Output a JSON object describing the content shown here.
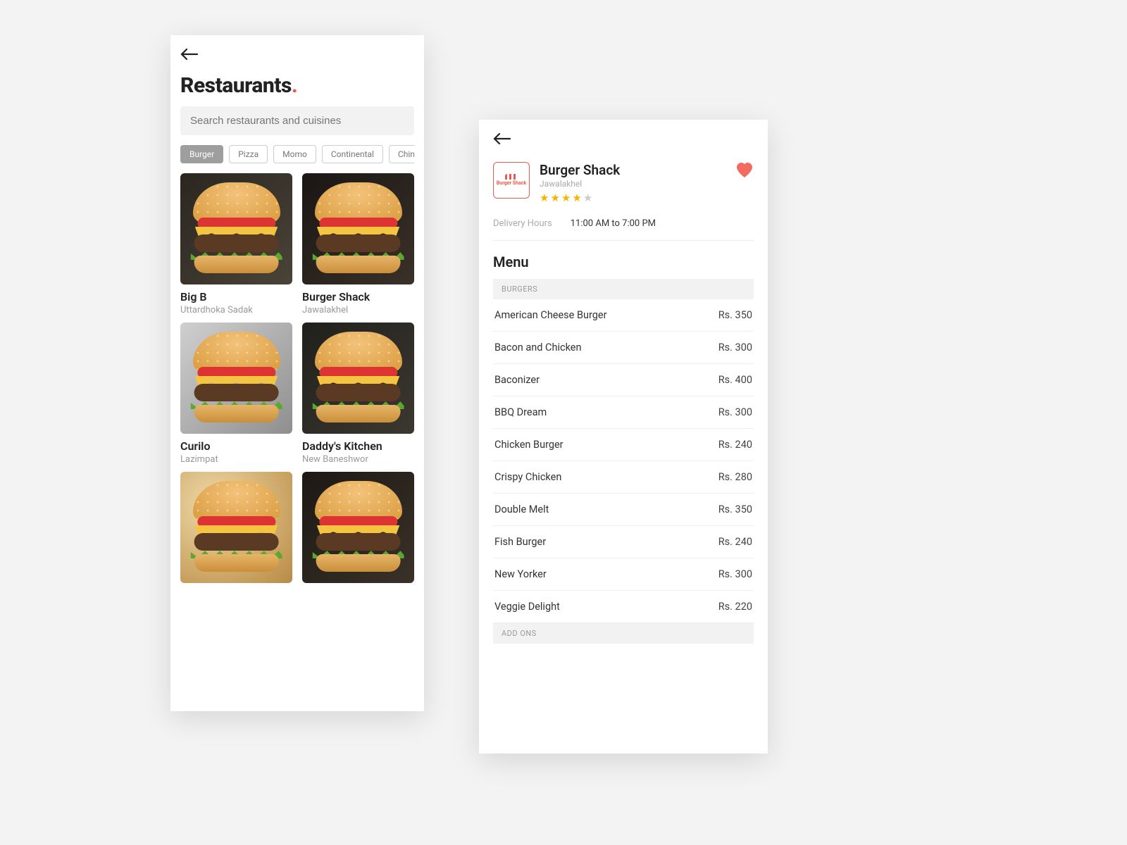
{
  "left": {
    "title": "Restaurants",
    "search_placeholder": "Search restaurants and cuisines",
    "chips": [
      "Burger",
      "Pizza",
      "Momo",
      "Continental",
      "Chinese"
    ],
    "active_chip_index": 0,
    "cards": [
      {
        "name": "Big B",
        "sub": "Uttardhoka Sadak"
      },
      {
        "name": "Burger Shack",
        "sub": "Jawalakhel"
      },
      {
        "name": "Curilo",
        "sub": "Lazimpat"
      },
      {
        "name": "Daddy's Kitchen",
        "sub": "New Baneshwor"
      },
      {
        "name": "",
        "sub": ""
      },
      {
        "name": "",
        "sub": ""
      }
    ]
  },
  "right": {
    "restaurant": {
      "name": "Burger Shack",
      "location": "Jawalakhel",
      "logo_text": "Burger Shack",
      "rating_filled": 4,
      "rating_total": 5,
      "favorited": true
    },
    "delivery": {
      "label": "Delivery Hours",
      "value": "11:00 AM to 7:00 PM"
    },
    "menu_title": "Menu",
    "sections": [
      {
        "title": "BURGERS",
        "items": [
          {
            "name": "American Cheese Burger",
            "price": "Rs. 350"
          },
          {
            "name": "Bacon and Chicken",
            "price": "Rs. 300"
          },
          {
            "name": "Baconizer",
            "price": "Rs. 400"
          },
          {
            "name": "BBQ Dream",
            "price": "Rs. 300"
          },
          {
            "name": "Chicken Burger",
            "price": "Rs. 240"
          },
          {
            "name": "Crispy Chicken",
            "price": "Rs. 280"
          },
          {
            "name": "Double Melt",
            "price": "Rs. 350"
          },
          {
            "name": "Fish Burger",
            "price": "Rs. 240"
          },
          {
            "name": "New Yorker",
            "price": "Rs. 300"
          },
          {
            "name": "Veggie Delight",
            "price": "Rs. 220"
          }
        ]
      },
      {
        "title": "ADD ONS",
        "items": []
      }
    ]
  },
  "colors": {
    "accent": "#f05a4f",
    "star": "#f5b400",
    "heart": "#f36b60"
  }
}
